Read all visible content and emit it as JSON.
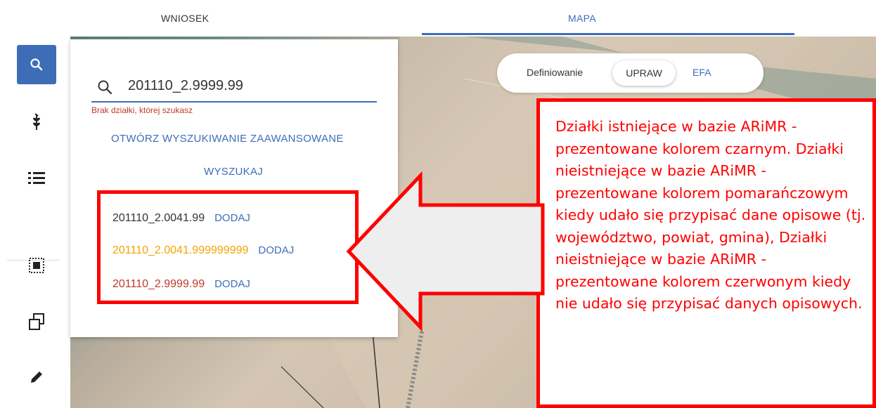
{
  "tabs": {
    "wniosek": "WNIOSEK",
    "mapa": "MAPA"
  },
  "toolbar": {
    "items": [
      "search-icon",
      "plant-icon",
      "list-icon",
      "select-area-icon",
      "copy-icon",
      "pencil-icon"
    ],
    "active_color": "#3e6db8"
  },
  "search": {
    "value": "201110_2.9999.99",
    "error": "Brak działki, której szukasz",
    "advanced_link": "OTWÓRZ WYSZUKIWANIE ZAAWANSOWANE",
    "search_button": "WYSZUKAJ"
  },
  "results": [
    {
      "number": "201110_2.0041.99",
      "action": "DODAJ",
      "color": "#333333"
    },
    {
      "number": "201110_2.0041.999999999",
      "action": "DODAJ",
      "color": "#f0a500"
    },
    {
      "number": "201110_2.9999.99",
      "action": "DODAJ",
      "color": "#c0392b"
    }
  ],
  "toggle": {
    "label": "Definiowanie",
    "upraw": "UPRAW",
    "efa": "EFA"
  },
  "callout": {
    "text": "Działki istniejące w bazie ARiMR - prezentowane kolorem czarnym. Działki nieistniejące w bazie ARiMR - prezentowane kolorem pomarańczowym kiedy udało się przypisać dane opisowe (tj. województwo, powiat, gmina), Działki nieistniejące w bazie ARiMR - prezentowane kolorem czerwonym kiedy nie udało się przypisać danych opisowych."
  },
  "colors": {
    "accent": "#3e6db8",
    "annotation": "#ff0000"
  }
}
